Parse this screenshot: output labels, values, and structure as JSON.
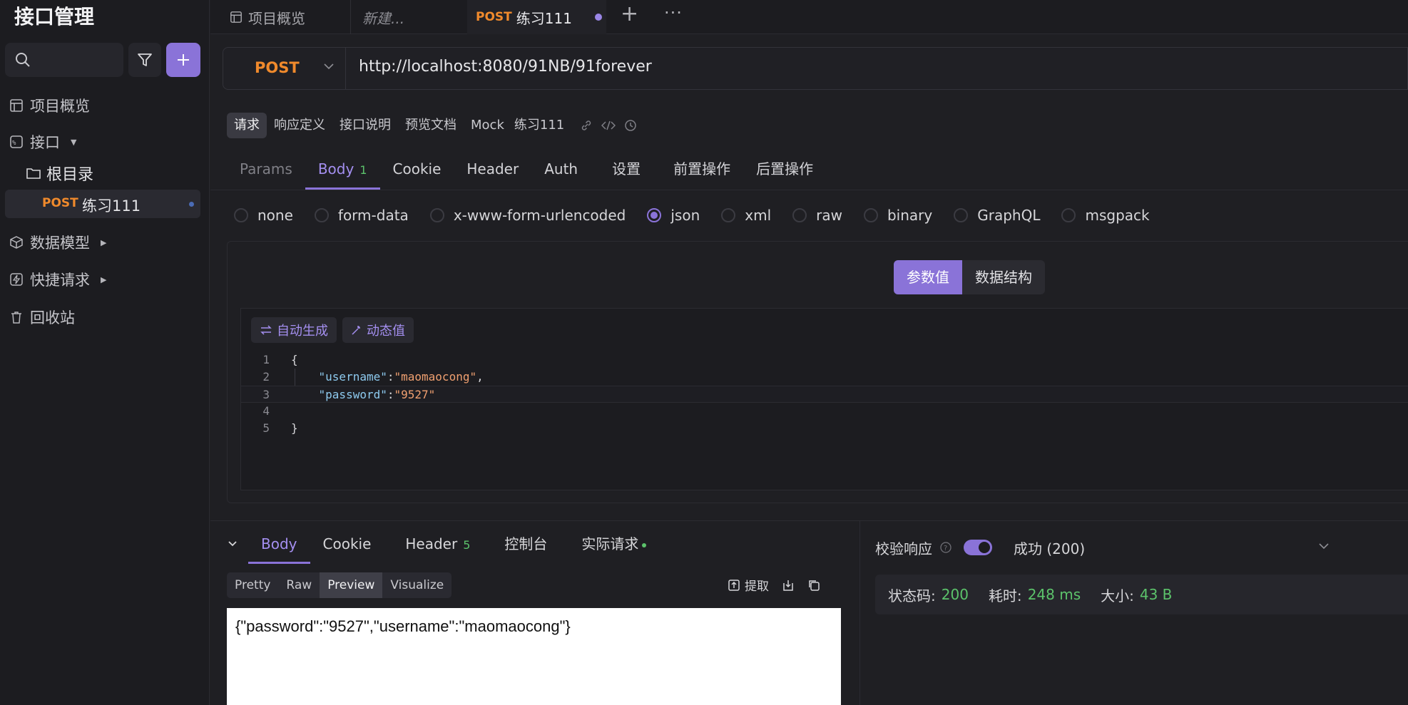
{
  "app_title": "接口管理",
  "sidebar": {
    "items": [
      {
        "label": "项目概览",
        "icon": "layout-icon"
      },
      {
        "label": "接口",
        "icon": "api-icon"
      },
      {
        "label": "数据模型",
        "icon": "cube-icon"
      },
      {
        "label": "快捷请求",
        "icon": "lightning-icon"
      },
      {
        "label": "回收站",
        "icon": "trash-icon"
      }
    ],
    "tree_root": "根目录",
    "tree_selected": {
      "method": "POST",
      "name": "练习111"
    }
  },
  "tabs": {
    "overview": "项目概览",
    "new": "新建...",
    "active_method": "POST",
    "active_name": "练习111",
    "more": "···"
  },
  "request": {
    "method": "POST",
    "url": "http://localhost:8080/91NB/91forever"
  },
  "subtabs": [
    "请求",
    "响应定义",
    "接口说明",
    "预览文档",
    "Mock",
    "练习111"
  ],
  "param_tabs": {
    "params": "Params",
    "body": "Body",
    "body_count": "1",
    "cookie": "Cookie",
    "header": "Header",
    "auth": "Auth",
    "settings": "设置",
    "pre": "前置操作",
    "post": "后置操作"
  },
  "body_types": [
    "none",
    "form-data",
    "x-www-form-urlencoded",
    "json",
    "xml",
    "raw",
    "binary",
    "GraphQL",
    "msgpack"
  ],
  "body_type_selected": "json",
  "segment": {
    "values": "参数值",
    "schema": "数据结构"
  },
  "editor_tools": {
    "auto": "自动生成",
    "dynamic": "动态值"
  },
  "code_lines": [
    {
      "n": "1",
      "text": "{"
    },
    {
      "n": "2",
      "key": "\"username\"",
      "sep": ":",
      "val": "\"maomaocong\"",
      "end": ","
    },
    {
      "n": "3",
      "key": "\"password\"",
      "sep": ":",
      "val": "\"9527\"",
      "end": ""
    },
    {
      "n": "4",
      "text": ""
    },
    {
      "n": "5",
      "text": "}"
    }
  ],
  "response": {
    "tabs": {
      "body": "Body",
      "cookie": "Cookie",
      "header": "Header",
      "header_count": "5",
      "console": "控制台",
      "actual": "实际请求"
    },
    "formats": [
      "Pretty",
      "Raw",
      "Preview",
      "Visualize"
    ],
    "format_selected": "Preview",
    "extract": "提取",
    "preview_text": "{\"password\":\"9527\",\"username\":\"maomaocong\"}",
    "validate_label": "校验响应",
    "validate_result": "成功 (200)",
    "status_label": "状态码:",
    "status_value": "200",
    "time_label": "耗时:",
    "time_value": "248 ms",
    "size_label": "大小:",
    "size_value": "43 B"
  },
  "colors": {
    "accent": "#8a73d8",
    "method_post": "#f08a2c",
    "success": "#5cc36b"
  }
}
